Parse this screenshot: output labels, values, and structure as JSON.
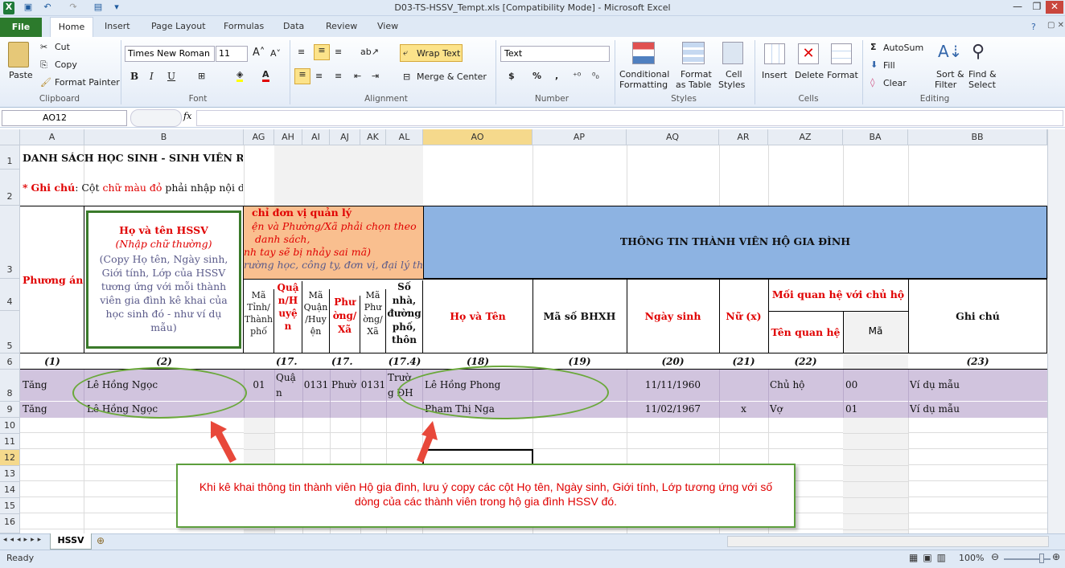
{
  "window": {
    "title": "D03-TS-HSSV_Tempt.xls  [Compatibility Mode]  -  Microsoft Excel"
  },
  "tabs": {
    "file": "File",
    "home": "Home",
    "insert": "Insert",
    "page_layout": "Page Layout",
    "formulas": "Formulas",
    "data": "Data",
    "review": "Review",
    "view": "View"
  },
  "ribbon": {
    "clipboard": {
      "paste": "Paste",
      "cut": "Cut",
      "copy": "Copy",
      "format_painter": "Format Painter",
      "group": "Clipboard"
    },
    "font": {
      "name": "Times New Roman",
      "size": "11",
      "bold": "B",
      "italic": "I",
      "underline": "U",
      "group": "Font"
    },
    "alignment": {
      "wrap": "Wrap Text",
      "merge": "Merge & Center",
      "group": "Alignment"
    },
    "number": {
      "format": "Text",
      "currency": "$",
      "percent": "%",
      "comma": ",",
      "group": "Number"
    },
    "styles": {
      "cond1": "Conditional",
      "cond2": "Formatting",
      "fmt1": "Format",
      "fmt2": "as Table",
      "cell1": "Cell",
      "cell2": "Styles",
      "group": "Styles"
    },
    "cells": {
      "insert": "Insert",
      "delete": "Delete",
      "format": "Format",
      "group": "Cells"
    },
    "editing": {
      "autosum": "AutoSum",
      "fill": "Fill",
      "clear": "Clear",
      "sort1": "Sort &",
      "sort2": "Filter",
      "find1": "Find &",
      "find2": "Select",
      "group": "Editing"
    }
  },
  "formula": {
    "namebox": "AO12",
    "fx": "fx"
  },
  "columns": [
    "A",
    "B",
    "AG",
    "AH",
    "AI",
    "AJ",
    "AK",
    "AL",
    "AO",
    "AP",
    "AQ",
    "AR",
    "AZ",
    "BA",
    "BB"
  ],
  "rows": [
    "1",
    "2",
    "3",
    "4",
    "5",
    "6",
    "8",
    "9",
    "10",
    "11",
    "12",
    "13",
    "14",
    "15",
    "16"
  ],
  "sheet": {
    "r1": "DANH SÁCH HỌC SINH - SINH VIÊN R",
    "r2_star": "*",
    "r2_bold": "Ghi chú",
    "r2_a": ": Cột ",
    "r2_red": "chữ màu đỏ",
    "r2_b": " phải nhập nội dung",
    "phuong_an": "Phương án",
    "b_title": "Họ và tên HSSV",
    "b_sub": "(Nhập chữ thường)",
    "b_copy": "(Copy Họ tên, Ngày sinh, Giới tính, Lớp của HSSV tương ứng với mỗi thành viên gia đình kê khai của học sinh đó - như ví dụ mẫu)",
    "orange1": "chỉ đơn vị quản lý",
    "orange2": "ện và Phường/Xã phải chọn theo",
    "orange3": "danh sách,",
    "orange4": "nh tay sẽ bị nhảy sai mã)",
    "orange5": "rường học, công ty, đơn vị, đại lý thu",
    "blue_header": "THÔNG TIN THÀNH VIÊN HỘ GIA ĐÌNH",
    "ag4": "Mã Tỉnh/ Thành phố",
    "ah4": "Quậ n/H uyệ n",
    "ai4": "Mã Quận /Huy ện",
    "aj4": "Phư ờng/ Xã",
    "ak4": "Mã Phư ờng/ Xã",
    "al4": "Số nhà, đường phố, thôn",
    "ao4": "Họ và Tên",
    "ap4": "Mã số BHXH",
    "aq4": "Ngày sinh",
    "ar4": "Nữ (x)",
    "rel": "Mối quan hệ với chủ hộ",
    "az5": "Tên quan hệ",
    "ba5": "Mã",
    "bb4": "Ghi chú",
    "r6": [
      "(1)",
      "(2)",
      "",
      "",
      "(17.",
      "",
      "(17.",
      "(17.4)",
      "(18)",
      "(19)",
      "(20)",
      "(21)",
      "(22)",
      "",
      "(23)"
    ],
    "r8": {
      "a": "Tăng",
      "b": "Lê Hồng Ngọc",
      "ag": "01",
      "ah": "Quậ n",
      "ai": "0131",
      "aj": "Phườ",
      "ak": "0131",
      "al": "Trườ g ĐH",
      "ao": "Lê Hồng Phong",
      "aq": "11/11/1960",
      "az": "Chủ hộ",
      "ba": "00",
      "bb": "Ví dụ mẫu"
    },
    "r9": {
      "a": "Tăng",
      "b": "Lê Hồng Ngọc",
      "ao": "Phạm Thị Nga",
      "aq": "11/02/1967",
      "ar": "x",
      "az": "Vợ",
      "ba": "01",
      "bb": "Ví dụ mẫu"
    }
  },
  "callout": "Khi kê khai thông tin thành viên Hộ gia đình, lưu ý copy các cột Họ tên, Ngày sinh, Giới tính, Lớp tương ứng với số dòng của các thành viên trong hộ gia đình HSSV đó.",
  "sheet_tab": "HSSV",
  "status": {
    "ready": "Ready",
    "zoom": "100%"
  },
  "colors": {
    "file_tab": "#2c7a2c",
    "header_blue": "#8db3e2",
    "header_orange": "#f9bf8f",
    "row_highlight": "#d1c4de",
    "callout_border": "#5c9e3c",
    "arrow": "#e8483a"
  }
}
